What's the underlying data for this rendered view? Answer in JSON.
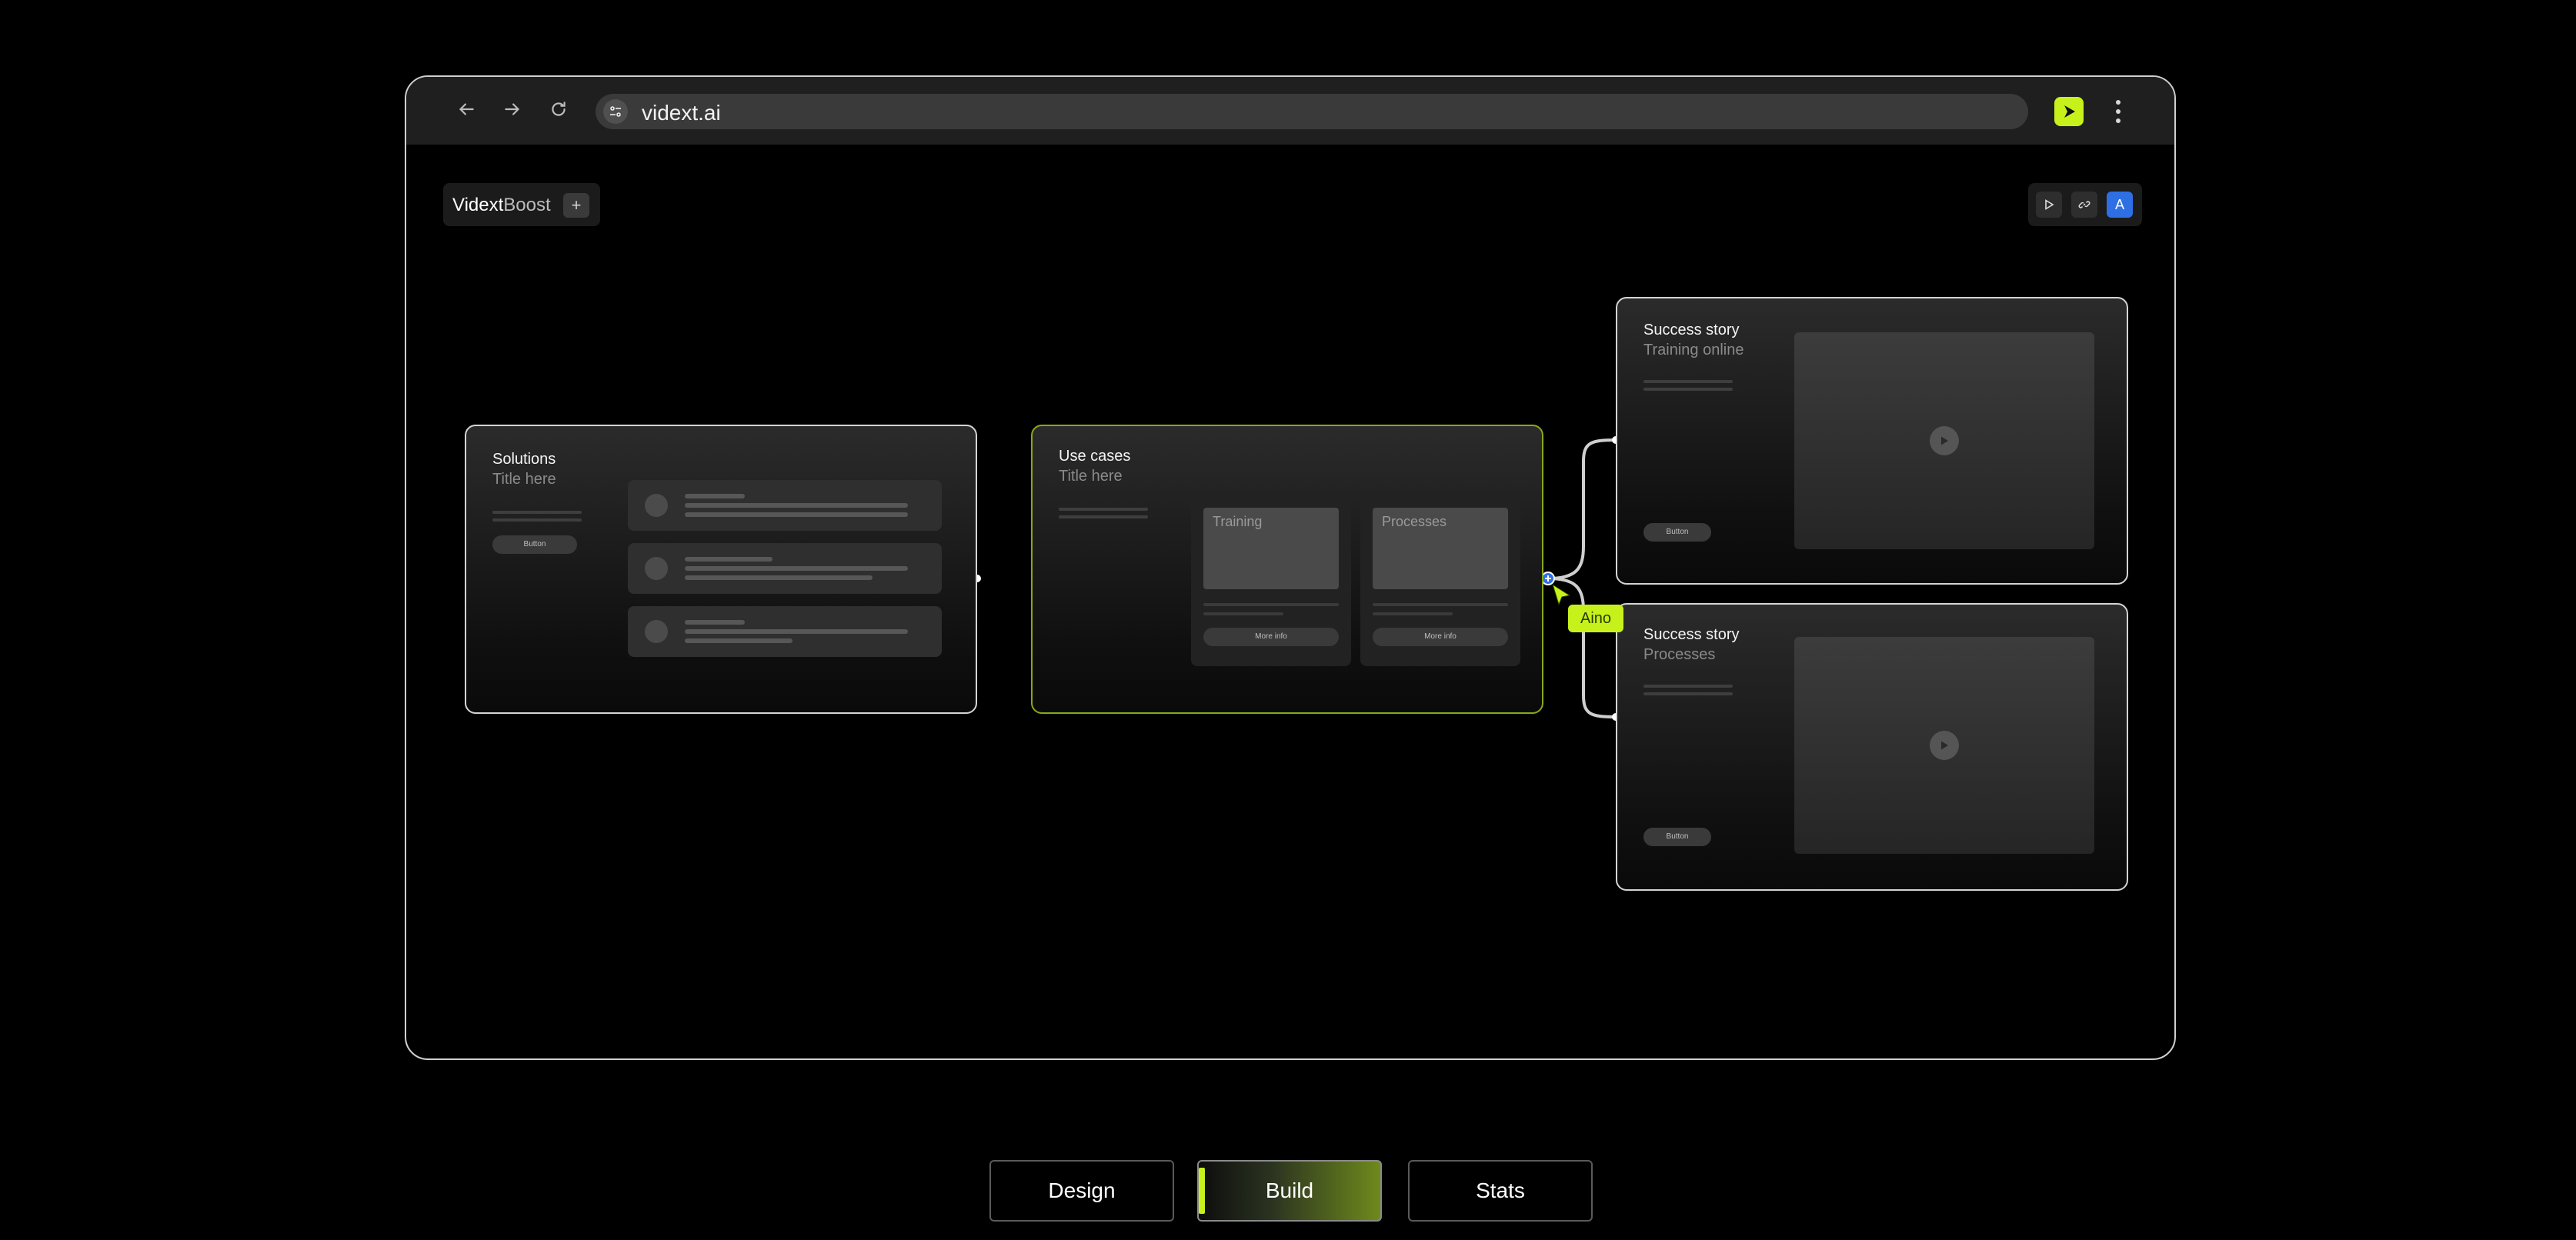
{
  "browser": {
    "url": "vidext.ai",
    "nav": {
      "back_icon": "arrow-left-icon",
      "forward_icon": "arrow-right-icon",
      "reload_icon": "reload-icon"
    },
    "extension_icon": "vidext-play-icon",
    "menu_icon": "kebab-menu-icon"
  },
  "toolbar": {
    "brand_part1": "Vidext",
    "brand_part2": "Boost",
    "add_label": "+",
    "tools": [
      "play-icon",
      "link-icon",
      "A"
    ]
  },
  "cards": {
    "solutions": {
      "title": "Solutions",
      "subtitle": "Title here",
      "button": "Button"
    },
    "use_cases": {
      "title": "Use cases",
      "subtitle": "Title here",
      "items": [
        {
          "label": "Training",
          "button": "More info"
        },
        {
          "label": "Processes",
          "button": "More info"
        }
      ]
    },
    "story_1": {
      "title": "Success story",
      "subtitle": "Training online",
      "button": "Button"
    },
    "story_2": {
      "title": "Success story",
      "subtitle": "Processes",
      "button": "Button"
    }
  },
  "collaborator": {
    "name": "Aino"
  },
  "tabs": [
    {
      "label": "Design",
      "active": false
    },
    {
      "label": "Build",
      "active": true
    },
    {
      "label": "Stats",
      "active": false
    }
  ],
  "colors": {
    "accent": "#c6f11b",
    "link_blue": "#2f6fe4",
    "card_border": "#d4d4d4"
  }
}
